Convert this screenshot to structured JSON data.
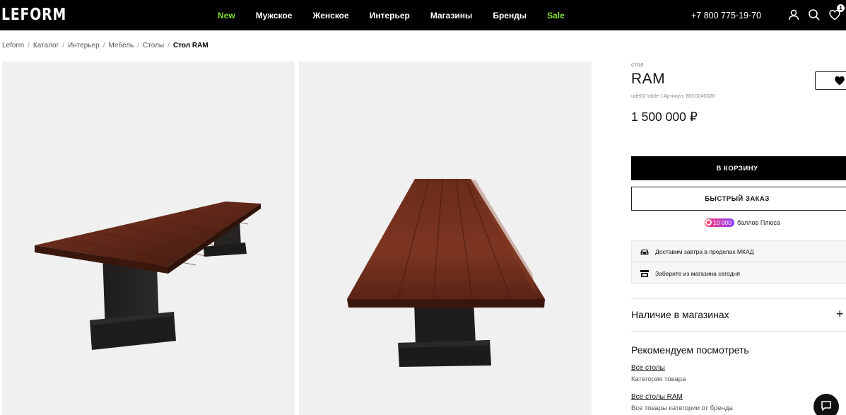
{
  "header": {
    "logo": "LEFORM",
    "nav": [
      {
        "label": "New",
        "accent": true
      },
      {
        "label": "Мужское",
        "accent": false
      },
      {
        "label": "Женское",
        "accent": false
      },
      {
        "label": "Интерьер",
        "accent": false
      },
      {
        "label": "Магазины",
        "accent": false
      },
      {
        "label": "Бренды",
        "accent": false
      },
      {
        "label": "Sale",
        "accent": true
      }
    ],
    "phone": "+7 800 775-19-70",
    "icons": [
      "user-icon",
      "search-icon",
      "heart-icon"
    ],
    "favorites_count": "1",
    "accent_color": "#7ee02a"
  },
  "breadcrumb": {
    "items": [
      "Leform",
      "Каталог",
      "Интерьер",
      "Мебель",
      "Столы"
    ],
    "separator": "/",
    "current": "Стол RAM"
  },
  "gallery": {
    "images": [
      "table-side-view",
      "table-end-view"
    ]
  },
  "product": {
    "kind": "стол",
    "title": "RAM",
    "sku_line": "ude02 table | Артикул: 8010240020",
    "price": "1 500 000 ₽",
    "add_to_cart": "В КОРЗИНУ",
    "quick_order": "БЫСТРЫЙ ЗАКАЗ",
    "plus_points": "10 000",
    "plus_label": "баллов Плюса",
    "delivery": [
      {
        "icon": "car-icon",
        "text": "Доставим завтра в пределах МКАД"
      },
      {
        "icon": "store-icon",
        "text": "Заберите из магазина сегодня"
      }
    ],
    "stock_label": "Наличие в магазинах",
    "stock_toggle": "+"
  },
  "recommend": {
    "title": "Рекомендуем посмотреть",
    "items": [
      {
        "link": "Все столы",
        "sub": "Категория товара"
      },
      {
        "link": "Все столы RAM",
        "sub": "Все товары категории от бренда"
      }
    ]
  }
}
